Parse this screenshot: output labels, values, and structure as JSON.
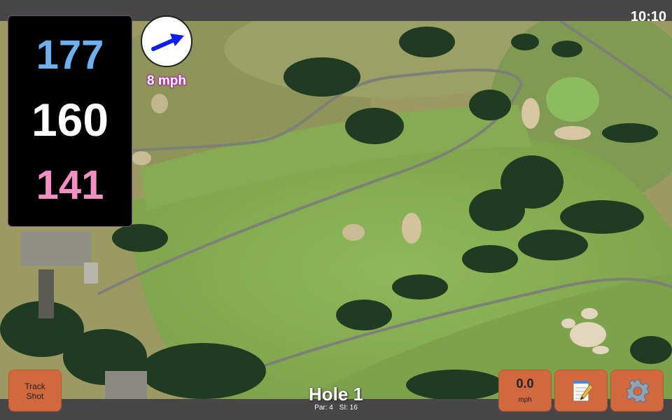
{
  "status": {
    "time": "10:10"
  },
  "distances": {
    "back": "177",
    "middle": "160",
    "front": "141"
  },
  "wind": {
    "speed_label": "8 mph",
    "direction_icon": "arrow-icon",
    "arrow_color": "#0a1ee6"
  },
  "hole": {
    "title": "Hole 1",
    "par_label": "Par: 4",
    "si_label": "SI: 16"
  },
  "buttons": {
    "track_shot_line1": "Track",
    "track_shot_line2": "Shot",
    "speed_value": "0.0",
    "speed_unit": "mph",
    "notes_icon": "notepad-icon",
    "settings_icon": "gear-icon"
  },
  "colors": {
    "back_distance": "#6fb1ef",
    "middle_distance": "#ffffff",
    "front_distance": "#f28fc3",
    "button_bg": "#d2683d",
    "bar_bg": "#474747"
  }
}
